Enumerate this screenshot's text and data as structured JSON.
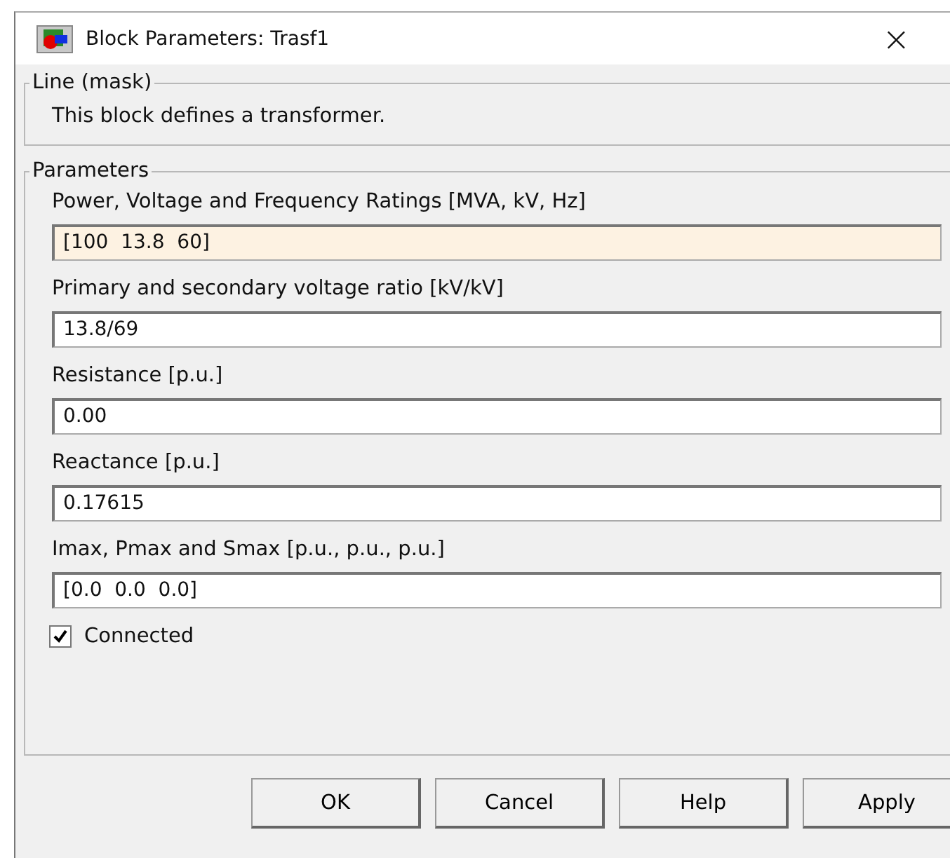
{
  "window": {
    "title": "Block Parameters: Trasf1",
    "close": "×"
  },
  "mask": {
    "legend": "Line (mask)",
    "description": "This block defines a transformer."
  },
  "parameters": {
    "legend": "Parameters",
    "fields": [
      {
        "label": "Power, Voltage and Frequency Ratings [MVA, kV, Hz]",
        "value": "[100  13.8  60]",
        "focused": true
      },
      {
        "label": "Primary and secondary voltage ratio [kV/kV]",
        "value": "13.8/69",
        "focused": false
      },
      {
        "label": "Resistance [p.u.]",
        "value": "0.00",
        "focused": false
      },
      {
        "label": "Reactance [p.u.]",
        "value": "0.17615",
        "focused": false
      },
      {
        "label": "Imax, Pmax and Smax [p.u., p.u., p.u.]",
        "value": "[0.0  0.0  0.0]",
        "focused": false
      }
    ],
    "checkbox": {
      "label": "Connected",
      "checked": true
    }
  },
  "buttons": [
    "OK",
    "Cancel",
    "Help",
    "Apply"
  ]
}
